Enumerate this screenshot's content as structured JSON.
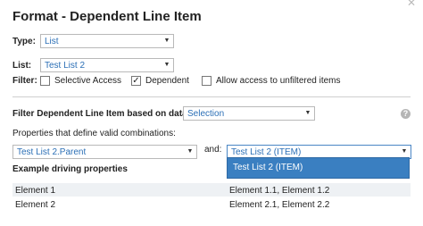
{
  "dialog": {
    "title": "Format - Dependent Line Item"
  },
  "type_field": {
    "label": "Type:",
    "value": "List"
  },
  "list_field": {
    "label": "List:",
    "value": "Test List 2"
  },
  "filter": {
    "label": "Filter:",
    "options": [
      {
        "label": "Selective Access",
        "checked": false
      },
      {
        "label": "Dependent",
        "checked": true
      },
      {
        "label": "Allow access to unfiltered items",
        "checked": false
      }
    ]
  },
  "filter_section": {
    "label": "Filter Dependent Line Item based on data in",
    "source": "Selection",
    "help_glyph": "?"
  },
  "properties": {
    "label": "Properties that define valid combinations:",
    "left": "Test List 2.Parent",
    "and_label": "and:",
    "right": "Test List 2 (ITEM)",
    "dropdown_option": "Test List 2 (ITEM)"
  },
  "example": {
    "heading": "Example driving properties",
    "rows": [
      {
        "left": "Element 1",
        "right": "Element 1.1, Element 1.2"
      },
      {
        "left": "Element 2",
        "right": "Element 2.1, Element 2.2"
      }
    ]
  },
  "icons": {
    "close": "close-icon",
    "dropdown": "chevron-down-icon",
    "help": "help-icon",
    "check": "checkmark-icon"
  },
  "colors": {
    "link_text": "#2b6fb6",
    "dropdown_highlight": "#3a7fc1",
    "row_shade": "#eef1f4"
  }
}
